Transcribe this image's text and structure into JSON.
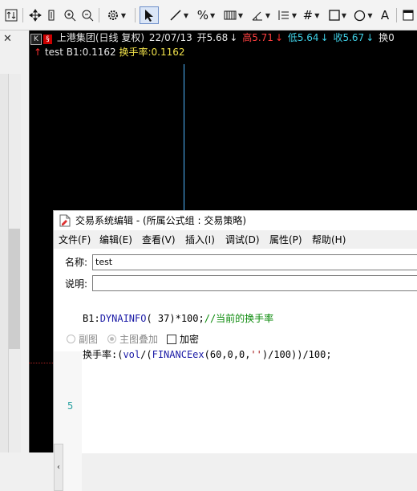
{
  "toolbar": {
    "percent_symbol": "%",
    "text_tool_symbol": "A",
    "icons": [
      "window-layout-icon",
      "move-icon",
      "vertical-bar-icon",
      "zoom-in-icon",
      "zoom-out-icon",
      "settings-icon",
      "cursor-icon",
      "line-tool-icon",
      "percent-tool-icon",
      "bar-tool-icon",
      "angle-tool-icon",
      "parallel-lines-icon",
      "grid-icon",
      "rectangle-tool-icon",
      "circle-tool-icon",
      "text-tool-icon"
    ]
  },
  "left_panel": {
    "close_glyph": "✕"
  },
  "quote": {
    "k_badge": "K",
    "right_badge": "§",
    "name": "上港集团(日线 复权)",
    "date": "22/07/13",
    "open_label": "开5.68",
    "high_label": "高5.71",
    "low_label": "低5.64",
    "close_label": "收5.67",
    "change_label": "换0",
    "arrow_down": "↓",
    "colors": {
      "name": "#e8e8e8",
      "open": "#e8e8e8",
      "high": "#ff4040",
      "low": "#3fd0e6",
      "close": "#3fd0e6",
      "arrow_red": "#ff3030",
      "arrow_cyan": "#3fd0e6"
    }
  },
  "indicator": {
    "arrow": "↑",
    "name": "test",
    "b1_label": "B1:0.1162",
    "turnover_label": "换手率:0.1162",
    "colors": {
      "arrow": "#ff3030",
      "b1": "#e8e8e8",
      "turnover": "#f0e14a"
    }
  },
  "dialog": {
    "title": "交易系统编辑 - (所属公式组 : 交易策略)",
    "menu": [
      "文件(F)",
      "编辑(E)",
      "查看(V)",
      "插入(I)",
      "调试(D)",
      "属性(P)",
      "帮助(H)"
    ],
    "name_label": "名称:",
    "name_value": "test",
    "desc_label": "说明:",
    "desc_value": "",
    "radio_sub_chart": "副图",
    "radio_main_overlay": "主图叠加",
    "encrypt_label": "加密",
    "scroll_left_glyph": "‹",
    "line_number": "5",
    "code": {
      "line1_ident": "B1:",
      "line1_func": "DYNAINFO",
      "line1_rest": "( 37)*100;",
      "line1_comment": "//当前的换手率",
      "line2_label": "换手率:(",
      "line2_vol": "vol",
      "line2_div": "/(",
      "line2_func": "FINANCEex",
      "line2_args": "(60,0,0,",
      "line2_str": "''",
      "line2_tail": ")/100))/100;"
    }
  }
}
